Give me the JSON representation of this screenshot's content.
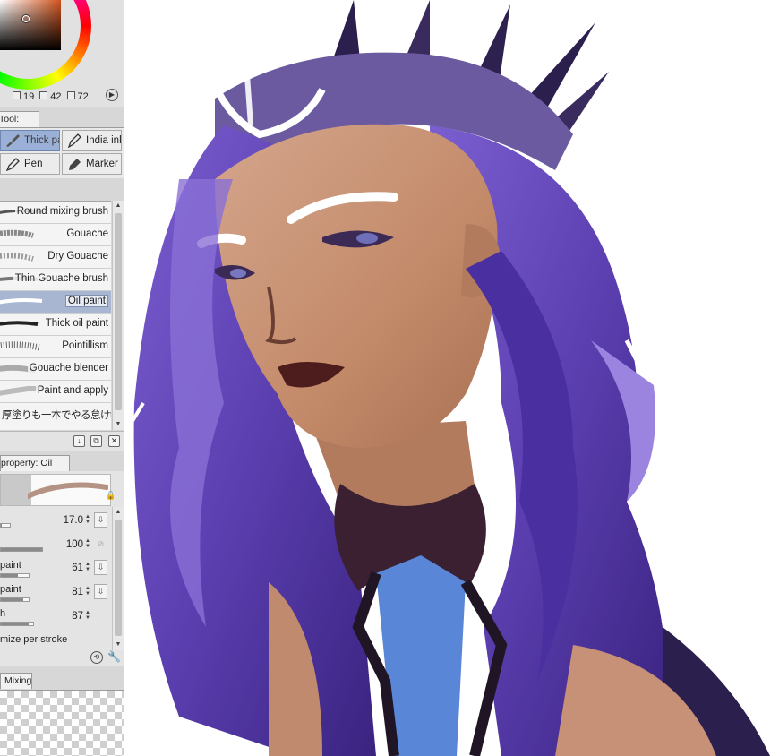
{
  "color_panel": {
    "values": [
      "19",
      "42",
      "72"
    ],
    "colors": {
      "main": "#d2531e"
    }
  },
  "subtool": {
    "tab_label": "Tool: Brush",
    "buttons": [
      {
        "label": "Thick pa",
        "icon": "thick-paint-brush-icon",
        "selected": true
      },
      {
        "label": "India ink",
        "icon": "india-ink-icon",
        "selected": false
      },
      {
        "label": "Pen",
        "icon": "pen-icon",
        "selected": false
      },
      {
        "label": "Marker",
        "icon": "marker-icon",
        "selected": false
      }
    ]
  },
  "brushes": {
    "items": [
      {
        "label": "Round mixing brush",
        "selected": false
      },
      {
        "label": "Gouache",
        "selected": false
      },
      {
        "label": "Dry Gouache",
        "selected": false
      },
      {
        "label": "Thin Gouache brush",
        "selected": false
      },
      {
        "label": "Oil paint",
        "selected": true
      },
      {
        "label": "Thick oil paint",
        "selected": false
      },
      {
        "label": "Pointillism",
        "selected": false
      },
      {
        "label": "Gouache blender",
        "selected": false
      },
      {
        "label": "Paint and apply",
        "selected": false
      },
      {
        "label": "厚塗りも一本でやる怠けt",
        "selected": false
      }
    ]
  },
  "property": {
    "tab_label": "property: Oil paint",
    "rows": [
      {
        "label": "",
        "value": "17.0",
        "fraction": 0.12
      },
      {
        "label": "",
        "value": "100",
        "fraction": 1.0
      },
      {
        "label": "paint",
        "value": "61",
        "fraction": 0.61
      },
      {
        "label": "paint",
        "value": "81",
        "fraction": 0.81
      },
      {
        "label": "h",
        "value": "87",
        "fraction": 0.87
      }
    ],
    "optimize_label": "mize per stroke"
  },
  "mixing": {
    "tab_label": "Mixing"
  },
  "artwork": {
    "description_icon": "painting-canvas",
    "colors": {
      "hair": "#5b3fb0",
      "hair_light": "#8a6fd6",
      "skin": "#c98f6e",
      "outfit": "#5a86d8",
      "dark": "#2a1a3a"
    }
  }
}
